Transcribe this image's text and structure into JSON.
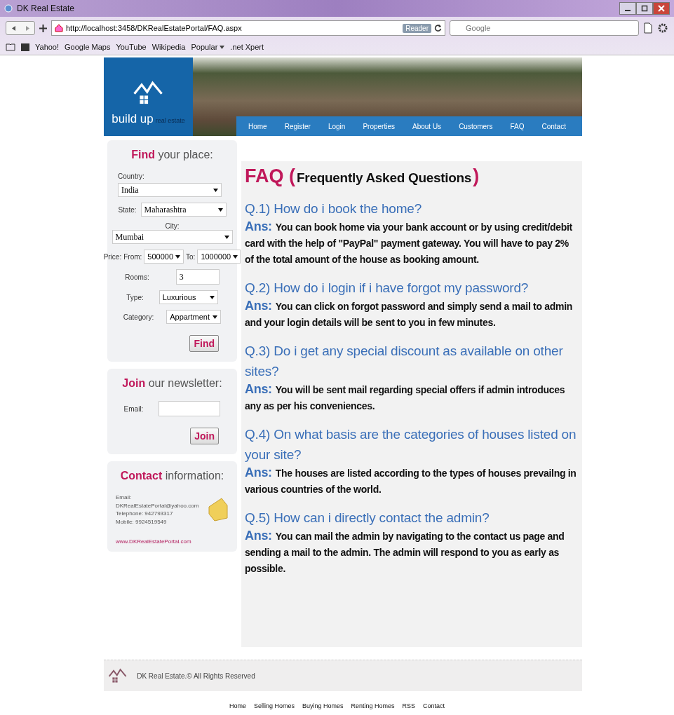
{
  "browser": {
    "title": "DK Real Estate",
    "url": "http://localhost:3458/DKRealEstatePortal/FAQ.aspx",
    "reader": "Reader",
    "search_placeholder": "Google",
    "bookmarks": [
      {
        "label": "Yahoo!",
        "kind": "link"
      },
      {
        "label": "Google Maps",
        "kind": "link"
      },
      {
        "label": "YouTube",
        "kind": "link"
      },
      {
        "label": "Wikipedia",
        "kind": "link"
      },
      {
        "label": "Popular",
        "kind": "menu"
      },
      {
        "label": ".net Xpert",
        "kind": "link"
      }
    ]
  },
  "header": {
    "logo_main": "build up",
    "logo_sub": "real estate",
    "nav": [
      {
        "label": "Home",
        "selected": false
      },
      {
        "label": "Register",
        "selected": false
      },
      {
        "label": "Login",
        "selected": false
      },
      {
        "label": "Properties",
        "selected": false
      },
      {
        "label": "About Us",
        "selected": false
      },
      {
        "label": "Customers",
        "selected": false
      },
      {
        "label": "FAQ",
        "selected": false
      },
      {
        "label": "Contact",
        "selected": false
      }
    ]
  },
  "search_panel": {
    "heading_accent": "Find",
    "heading_rest": "your place:",
    "country": {
      "label": "Country:",
      "value": "India"
    },
    "state": {
      "label": "State:",
      "value": "Maharashtra"
    },
    "city": {
      "label": "City:",
      "value": "Mumbai"
    },
    "price": {
      "label": "Price:",
      "from_label": "From:",
      "from": "500000",
      "to_label": "To:",
      "to": "1000000"
    },
    "rooms": {
      "label": "Rooms:",
      "value": "3"
    },
    "type": {
      "label": "Type:",
      "value": "Luxurious"
    },
    "category": {
      "label": "Category:",
      "value": "Appartment"
    },
    "button": "Find"
  },
  "newsletter": {
    "heading_accent": "Join",
    "heading_rest": "our newsletter:",
    "email_label": "Email:",
    "button": "Join"
  },
  "contact": {
    "heading_accent": "Contact",
    "heading_rest": "information:",
    "lines": [
      "Email:",
      "DKRealEstatePortal@yahoo.com",
      "Telephone: 942793317",
      "Mobile: 9924519549"
    ],
    "website": "www.DKRealEstatePortal.com"
  },
  "faq": {
    "title": {
      "abbr": "FAQ",
      "open": "(",
      "text": "Frequently Asked Questions",
      "close": ")"
    },
    "items": [
      {
        "question": "Q.1) How do i book the home?",
        "answer_label": "Ans:",
        "answer": "You can book home via your bank account or by using credit/debit card with the help of \"PayPal\" payment gateway. You will have to pay 2% of the total amount of the house as booking amount."
      },
      {
        "question": "Q.2) How do i login if i have forgot my password?",
        "answer_label": "Ans:",
        "answer": "You can click on forgot password and simply send a mail to admin and your login details will be sent to you in few minutes."
      },
      {
        "question": "Q.3) Do i get any special discount as available on other sites?",
        "answer_label": "Ans:",
        "answer": "You will be sent mail regarding special offers if admin introduces any as per his conveniences."
      },
      {
        "question": "Q.4) On what basis are the categories of houses listed on your site?",
        "answer_label": "Ans:",
        "answer": "The houses are listed according to the types of houses prevailng in various countries of the world."
      },
      {
        "question": "Q.5) How can i directly contact the admin?",
        "answer_label": "Ans:",
        "answer": "You can mail the admin by navigating to the contact us page and sending a mail to the admin. The admin will respond to you as early as possible."
      }
    ]
  },
  "footer": {
    "copyright": "DK Real Estate.© All Rights Reserved",
    "links": [
      "Home",
      "Selling Homes",
      "Buying Homes",
      "Renting Homes",
      "RSS",
      "Contact"
    ]
  }
}
